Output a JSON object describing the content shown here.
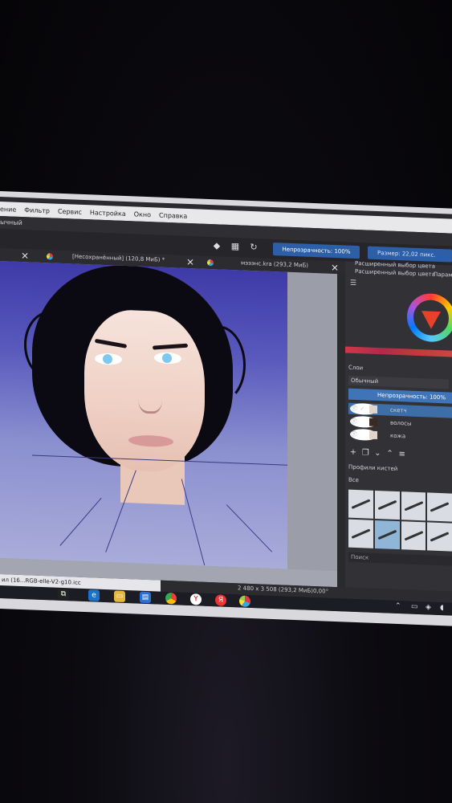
{
  "menu": {
    "items": [
      "ение",
      "Фильтр",
      "Сервис",
      "Настройка",
      "Окно",
      "Справка"
    ]
  },
  "modebar": {
    "mode": "ычный"
  },
  "toolbar": {
    "opacity_label": "Непрозрачность: 100%",
    "size_label": "Размер: 22,02 пикс."
  },
  "tabs": [
    {
      "title": "[Несохранённый] (120,8 МиБ) *"
    },
    {
      "title": "мэээнс.kra (293,2 МиБ)"
    }
  ],
  "docker": {
    "color_header_1": "Расширенный выбор цвета",
    "color_header_2": "Расширенный выбор цвета",
    "params_tab": "Параметр",
    "layers_title": "Слои",
    "blend_mode": "Обычный",
    "layer_opacity": "Непрозрачность:  100%",
    "layers": [
      {
        "name": "скетч",
        "active": true
      },
      {
        "name": "волосы",
        "active": false
      },
      {
        "name": "кожа",
        "active": false
      }
    ],
    "brush_presets_title": "Профили кистей",
    "brush_filter": "Все",
    "search_placeholder": "Поиск"
  },
  "status": {
    "image_size": "2 480 x 3 508 (293,2 МиБ)",
    "rotation": "0,00°"
  },
  "taskbar": {
    "icc_profile": "ил (16...RGB-elle-V2-g10.icc"
  },
  "icons": [
    "eraser-icon",
    "checker-icon",
    "reload-icon",
    "close-icon",
    "krita-icon",
    "eye-icon",
    "plus-icon",
    "edge-icon",
    "explorer-icon",
    "store-icon",
    "chrome-icon",
    "yandex-icon",
    "krita-icon"
  ],
  "colors": {
    "accent": "#2d5fa8",
    "active_layer": "#3d6ea8",
    "canvas_bg_top": "#3e3aa8",
    "iris": "#7ec7ee"
  }
}
